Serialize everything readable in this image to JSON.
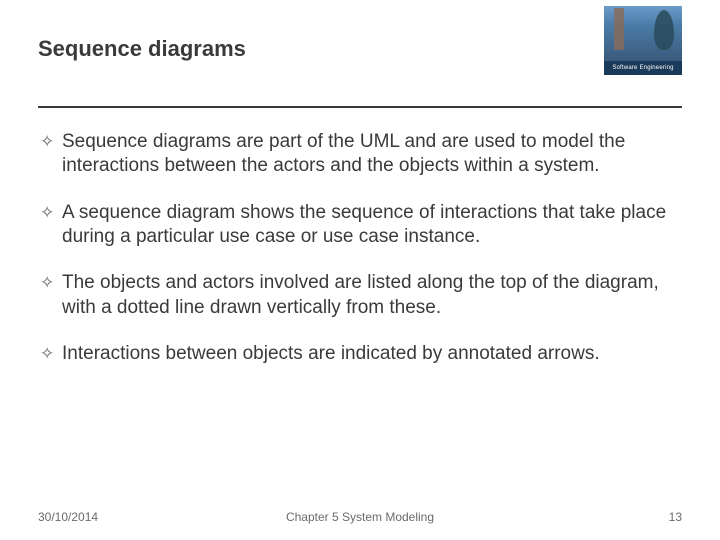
{
  "title": "Sequence diagrams",
  "logo": {
    "bar_text": "Software Engineering",
    "subtext": ""
  },
  "bullets": [
    "Sequence diagrams are part of the UML and are used to model the interactions between the actors and the objects within a system.",
    "A sequence diagram shows the sequence of interactions that take place during a particular use case or use case instance.",
    "The objects and actors involved are listed along the top of the diagram, with a dotted line drawn vertically from these.",
    "Interactions between objects are indicated by annotated arrows."
  ],
  "footer": {
    "date": "30/10/2014",
    "chapter": "Chapter 5 System Modeling",
    "page": "13"
  }
}
